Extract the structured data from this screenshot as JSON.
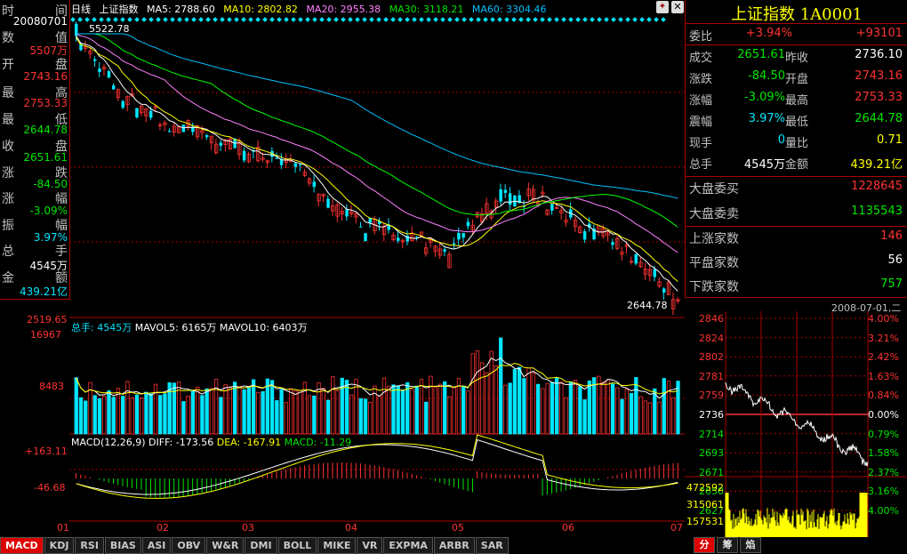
{
  "left": {
    "labels": [
      "时",
      "间",
      "数",
      "值",
      "开",
      "盘",
      "最",
      "高",
      "最",
      "低",
      "收",
      "盘",
      "涨",
      "跌",
      "涨",
      "幅",
      "振",
      "幅",
      "总",
      "手",
      "金",
      "额"
    ],
    "date": "20080701",
    "volume_wan": "5507万",
    "open": "2743.16",
    "high": "2753.33",
    "low": "2644.78",
    "close": "2651.61",
    "change": "-84.50",
    "pct": "-3.09%",
    "amplitude": "3.97%",
    "hands": "4545万",
    "amount": "439.21亿"
  },
  "mabar": {
    "period": "日线",
    "name": "上证指数",
    "ma5": "MA5: 2788.60",
    "ma10": "MA10: 2802.82",
    "ma20": "MA20: 2955.38",
    "ma30": "MA30: 3118.21",
    "ma60": "MA60: 3304.46"
  },
  "main": {
    "high_label": "5522.78",
    "low_label": "2644.78",
    "left_axis": "2519.65"
  },
  "volume": {
    "header_total": "总手: 4545万",
    "mavol5": "MAVOL5: 6165万",
    "mavol10": "MAVOL10: 6403万",
    "ticks": [
      "16967",
      "8483"
    ]
  },
  "macd": {
    "header": "MACD(12,26,9)",
    "diff": "DIFF: -173.56",
    "dea": "DEA: -167.91",
    "macd": "MACD: -11.29",
    "ticks": [
      "+163.11",
      "-46.68"
    ]
  },
  "x_axis": [
    "01",
    "02",
    "03",
    "04",
    "05",
    "06",
    "07"
  ],
  "right": {
    "title": "上证指数 1A0001",
    "weibi_k": "委比",
    "weibi_v": "+3.94%",
    "weicha": "+93101",
    "rows": [
      {
        "k1": "成交",
        "v1": "2651.61",
        "k2": "昨收",
        "v2": "2736.10",
        "c1": "grn",
        "c2": "wht"
      },
      {
        "k1": "涨跌",
        "v1": "-84.50",
        "k2": "开盘",
        "v2": "2743.16",
        "c1": "grn",
        "c2": "red"
      },
      {
        "k1": "涨幅",
        "v1": "-3.09%",
        "k2": "最高",
        "v2": "2753.33",
        "c1": "grn",
        "c2": "red"
      },
      {
        "k1": "震幅",
        "v1": "3.97%",
        "k2": "最低",
        "v2": "2644.78",
        "c1": "cyan",
        "c2": "grn"
      },
      {
        "k1": "现手",
        "v1": "0",
        "k2": "量比",
        "v2": "0.71",
        "c1": "cyan",
        "c2": "yel"
      },
      {
        "k1": "总手",
        "v1": "4545万",
        "k2": "金额",
        "v2": "439.21亿",
        "c1": "wht",
        "c2": "yel"
      }
    ],
    "rows2": [
      {
        "k": "大盘委买",
        "v": "1228645",
        "c": "red"
      },
      {
        "k": "大盘委卖",
        "v": "1135543",
        "c": "grn"
      },
      {
        "k": "上涨家数",
        "v": "146",
        "c": "red"
      },
      {
        "k": "平盘家数",
        "v": "56",
        "c": "wht"
      },
      {
        "k": "下跌家数",
        "v": "757",
        "c": "grn"
      }
    ],
    "mini_date": "2008-07-01,二",
    "mini_left": [
      "2846",
      "2824",
      "2802",
      "2781",
      "2759",
      "2736",
      "2714",
      "2693",
      "2671",
      "2650",
      "2627"
    ],
    "mini_right": [
      "4.00%",
      "3.21%",
      "2.42%",
      "1.63%",
      "0.84%",
      "0.00%",
      "0.79%",
      "1.58%",
      "2.37%",
      "3.16%",
      "4.00%"
    ],
    "mini_vol": [
      "472592",
      "315061",
      "157531"
    ]
  },
  "tabs": [
    "MACD",
    "KDJ",
    "RSI",
    "BIAS",
    "ASI",
    "OBV",
    "W&R",
    "DMI",
    "BOLL",
    "MIKE",
    "VR",
    "EXPMA",
    "ARBR",
    "SAR"
  ],
  "rtabs": [
    "分",
    "筹",
    "焰"
  ],
  "colors": {
    "up": "#ff3232",
    "down": "#00e5ff",
    "ma5": "#ffffff",
    "ma10": "#ffff00",
    "ma20": "#ff80ff",
    "ma30": "#00ff00",
    "ma60": "#00c0ff"
  }
}
